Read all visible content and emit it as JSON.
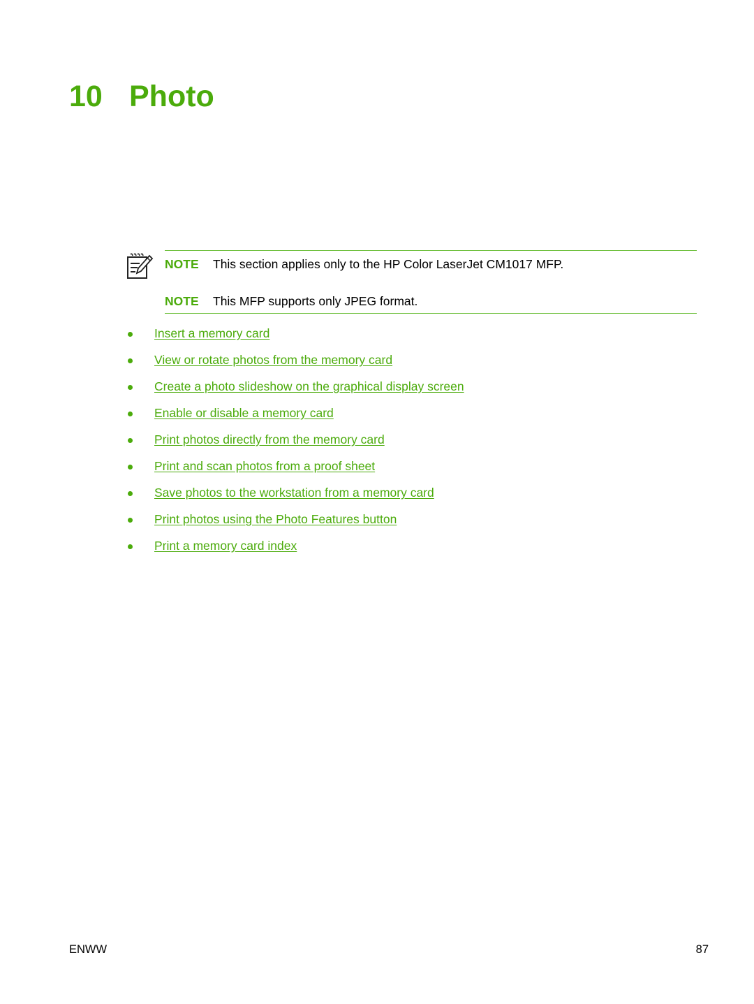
{
  "chapter": {
    "number": "10",
    "title": "Photo"
  },
  "notes": [
    {
      "label": "NOTE",
      "text": "This section applies only to the HP Color LaserJet CM1017 MFP."
    },
    {
      "label": "NOTE",
      "text": "This MFP supports only JPEG format."
    }
  ],
  "note_icon": "note-pencil-icon",
  "links": [
    {
      "text": "Insert a memory card"
    },
    {
      "text": "View or rotate photos from the memory card"
    },
    {
      "text": "Create a photo slideshow on the graphical display screen"
    },
    {
      "text": "Enable or disable a memory card"
    },
    {
      "text": "Print photos directly from the memory card"
    },
    {
      "text": "Print and scan photos from a proof sheet"
    },
    {
      "text": "Save photos to the workstation from a memory card"
    },
    {
      "text": "Print photos using the Photo Features button"
    },
    {
      "text": "Print a memory card index"
    }
  ],
  "footer": {
    "left": "ENWW",
    "page_number": "87"
  },
  "colors": {
    "accent": "#4bab0b",
    "rule": "#6cbf3a",
    "text": "#000000"
  }
}
